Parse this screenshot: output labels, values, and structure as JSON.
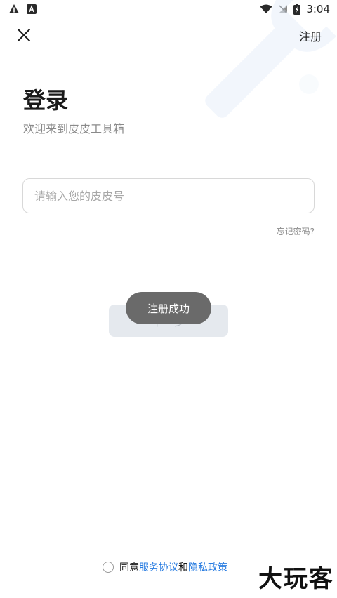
{
  "status_bar": {
    "time": "3:04",
    "icons_left": [
      "warning-icon",
      "text-a-icon"
    ],
    "icons_right": [
      "wifi-icon",
      "signal-off-icon",
      "battery-charging-icon"
    ]
  },
  "top_bar": {
    "close_icon": "close-icon",
    "register_label": "注册"
  },
  "header": {
    "title": "登录",
    "subtitle": "欢迎来到皮皮工具箱"
  },
  "form": {
    "account_placeholder": "请输入您的皮皮号",
    "account_value": "",
    "forgot_label": "忘记密码?",
    "next_label": "下一步"
  },
  "toast": {
    "message": "注册成功"
  },
  "agreement": {
    "prefix": "同意",
    "service_link": "服务协议",
    "conjunction": "和",
    "privacy_link": "隐私政策"
  },
  "watermark": {
    "text": "大玩客"
  },
  "colors": {
    "accent": "#2a7de1",
    "button_disabled_bg": "#e5e9ee",
    "toast_bg": "#6a6a6a",
    "watermark_tint": "#e8f0fb"
  }
}
